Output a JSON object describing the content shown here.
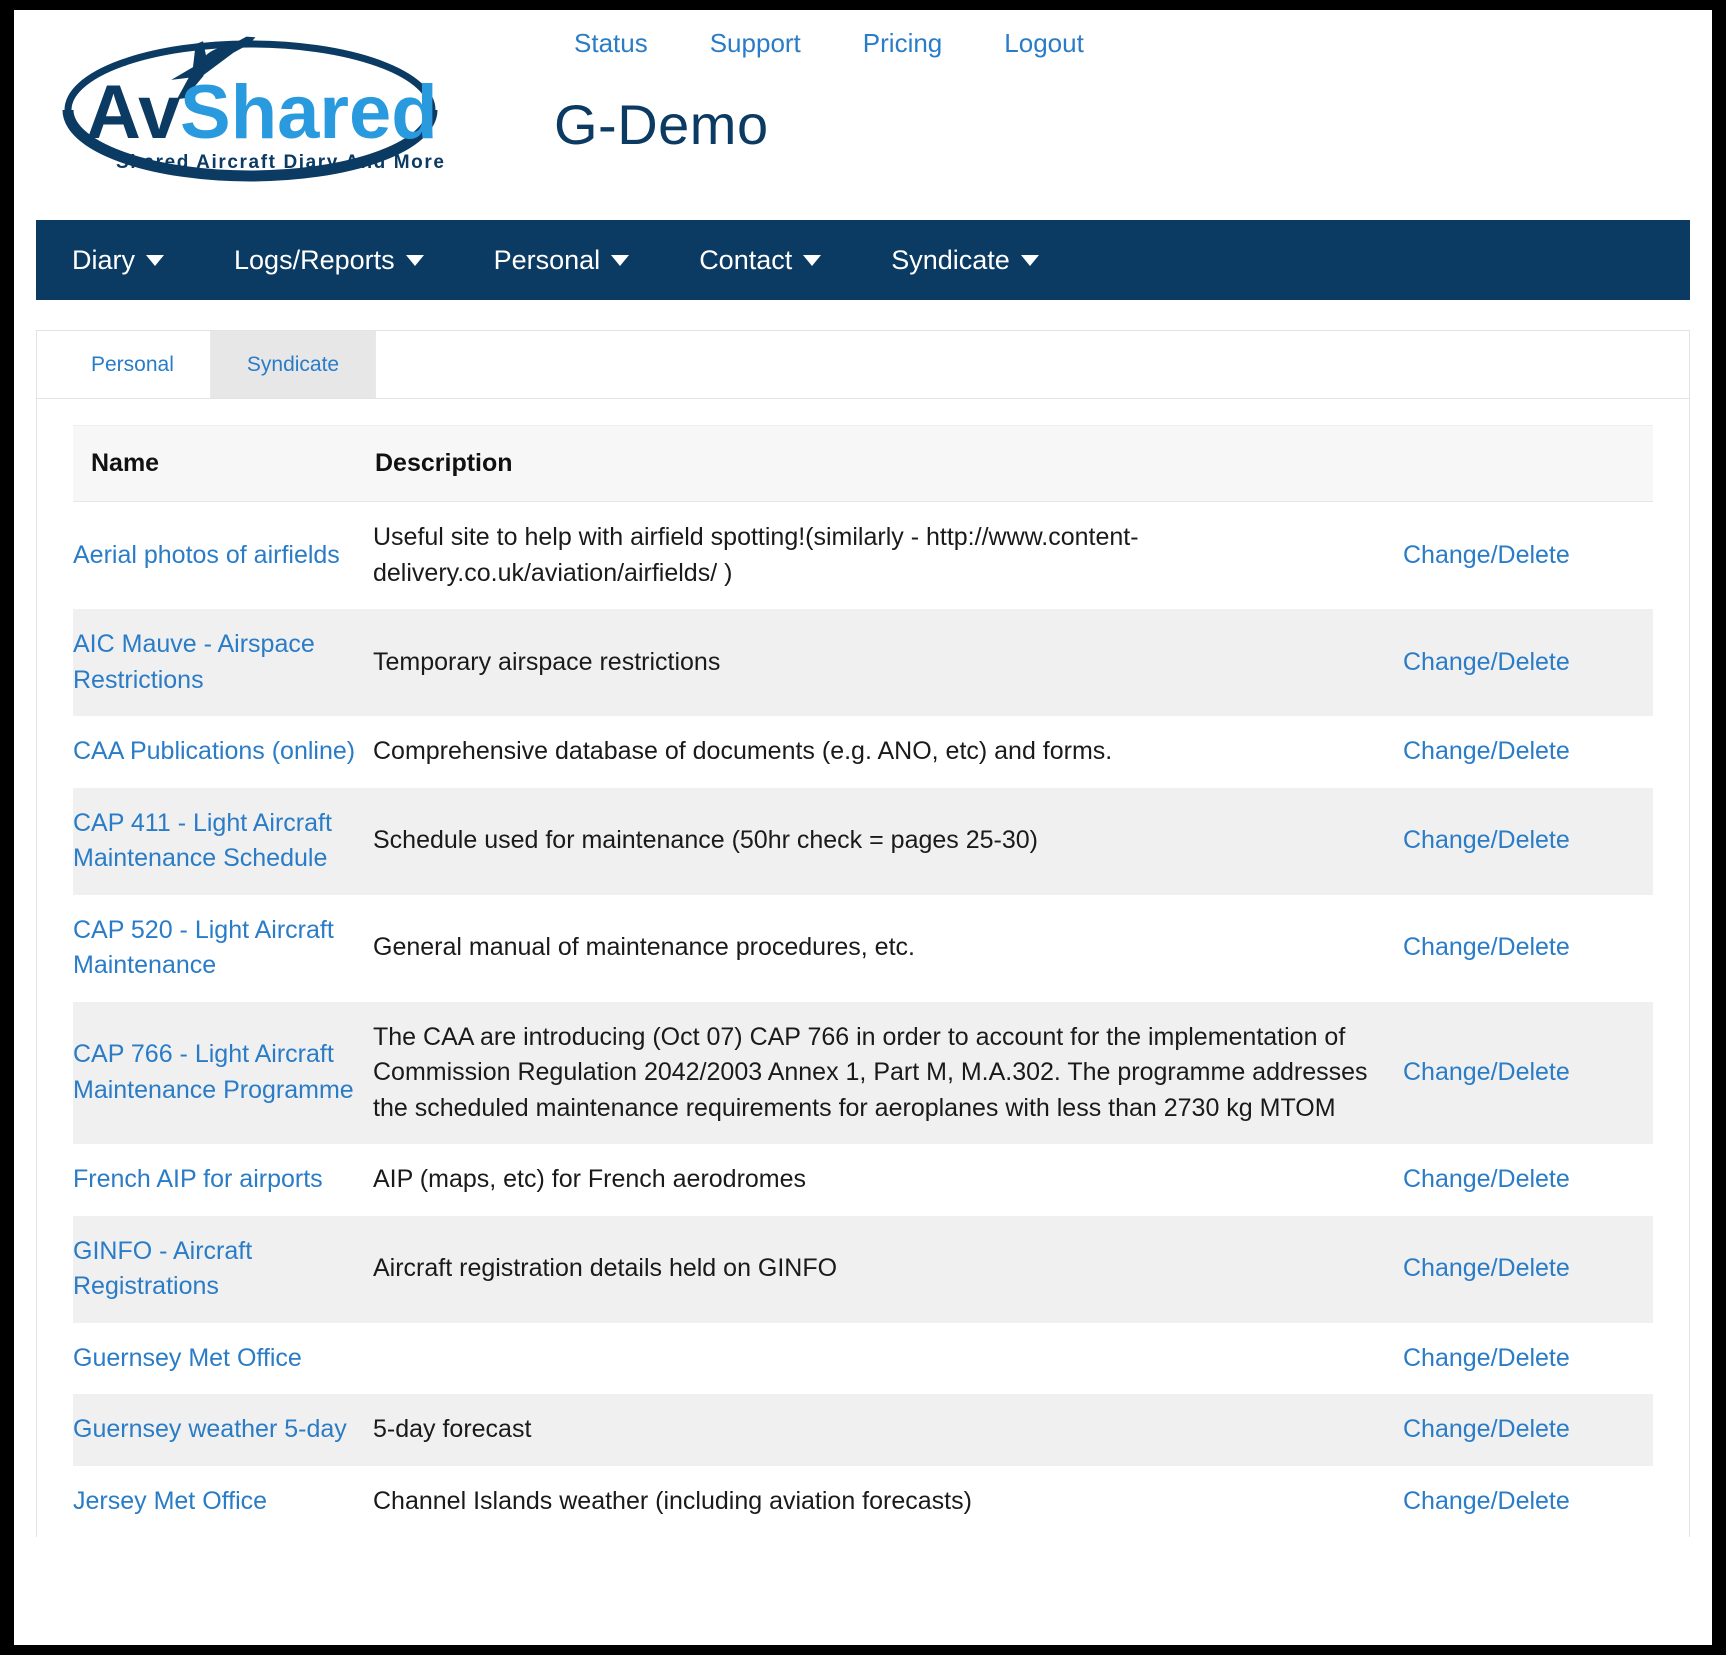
{
  "brand": {
    "name_part1": "Av",
    "name_part2": "Shared",
    "tagline": "Shared Aircraft Diary And More"
  },
  "header": {
    "title": "G-Demo",
    "top_links": [
      {
        "label": "Status"
      },
      {
        "label": "Support"
      },
      {
        "label": "Pricing"
      },
      {
        "label": "Logout"
      }
    ]
  },
  "nav": {
    "items": [
      {
        "label": "Diary"
      },
      {
        "label": "Logs/Reports"
      },
      {
        "label": "Personal"
      },
      {
        "label": "Contact"
      },
      {
        "label": "Syndicate"
      }
    ]
  },
  "tabs": [
    {
      "label": "Personal",
      "active": false
    },
    {
      "label": "Syndicate",
      "active": true
    }
  ],
  "table": {
    "columns": [
      "Name",
      "Description",
      ""
    ],
    "action_label": "Change/Delete",
    "rows": [
      {
        "name": "Aerial photos of airfields",
        "description": "Useful site to help with airfield spotting!(similarly - http://www.content-delivery.co.uk/aviation/airfields/ )"
      },
      {
        "name": "AIC Mauve - Airspace Restrictions",
        "description": "Temporary airspace restrictions"
      },
      {
        "name": "CAA Publications (online)",
        "description": "Comprehensive database of documents (e.g. ANO, etc) and forms."
      },
      {
        "name": "CAP 411 - Light Aircraft Maintenance Schedule",
        "description": "Schedule used for maintenance (50hr check = pages 25-30)"
      },
      {
        "name": "CAP 520 - Light Aircraft Maintenance",
        "description": "General manual of maintenance procedures, etc."
      },
      {
        "name": "CAP 766 - Light Aircraft Maintenance Programme",
        "description": "The CAA are introducing (Oct 07) CAP 766 in order to account for the implementation of Commission Regulation 2042/2003 Annex 1, Part M, M.A.302. The programme addresses the scheduled maintenance requirements for aeroplanes with less than 2730 kg MTOM"
      },
      {
        "name": "French AIP for airports",
        "description": "AIP (maps, etc) for French aerodromes"
      },
      {
        "name": "GINFO - Aircraft Registrations",
        "description": "Aircraft registration details held on GINFO"
      },
      {
        "name": "Guernsey Met Office",
        "description": ""
      },
      {
        "name": "Guernsey weather 5-day",
        "description": "5-day forecast"
      },
      {
        "name": "Jersey Met Office",
        "description": "Channel Islands weather (including aviation forecasts)"
      }
    ]
  },
  "colors": {
    "brand_dark": "#0b3a63",
    "brand_light": "#2a9ade",
    "link": "#2a7cc7",
    "nav_bg": "#0b3a63",
    "row_alt": "#f0f0f0",
    "tab_active": "#e7e7e7"
  }
}
